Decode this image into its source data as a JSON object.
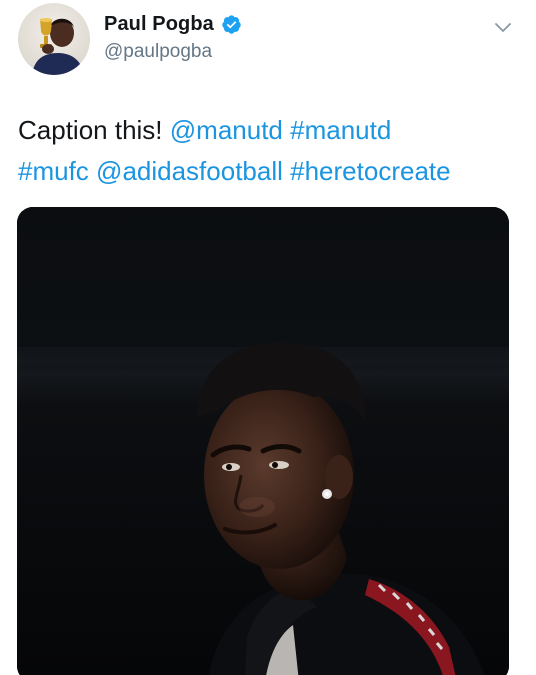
{
  "author": {
    "display_name": "Paul Pogba",
    "handle": "@paulpogba",
    "verified": true
  },
  "tweet": {
    "line1_text": "Caption this!",
    "line1_mention": "@manutd",
    "line1_hashtag": "#manutd",
    "line2_hashtag1": "#mufc",
    "line2_mention": "@adidasfootball",
    "line2_hashtag2": "#heretocreate"
  },
  "colors": {
    "link": "#1b95e0",
    "verified_badge": "#1da1f2",
    "handle": "#657786",
    "text": "#14171a"
  },
  "icons": {
    "verified": "verified-badge-icon",
    "menu": "chevron-down-icon"
  }
}
